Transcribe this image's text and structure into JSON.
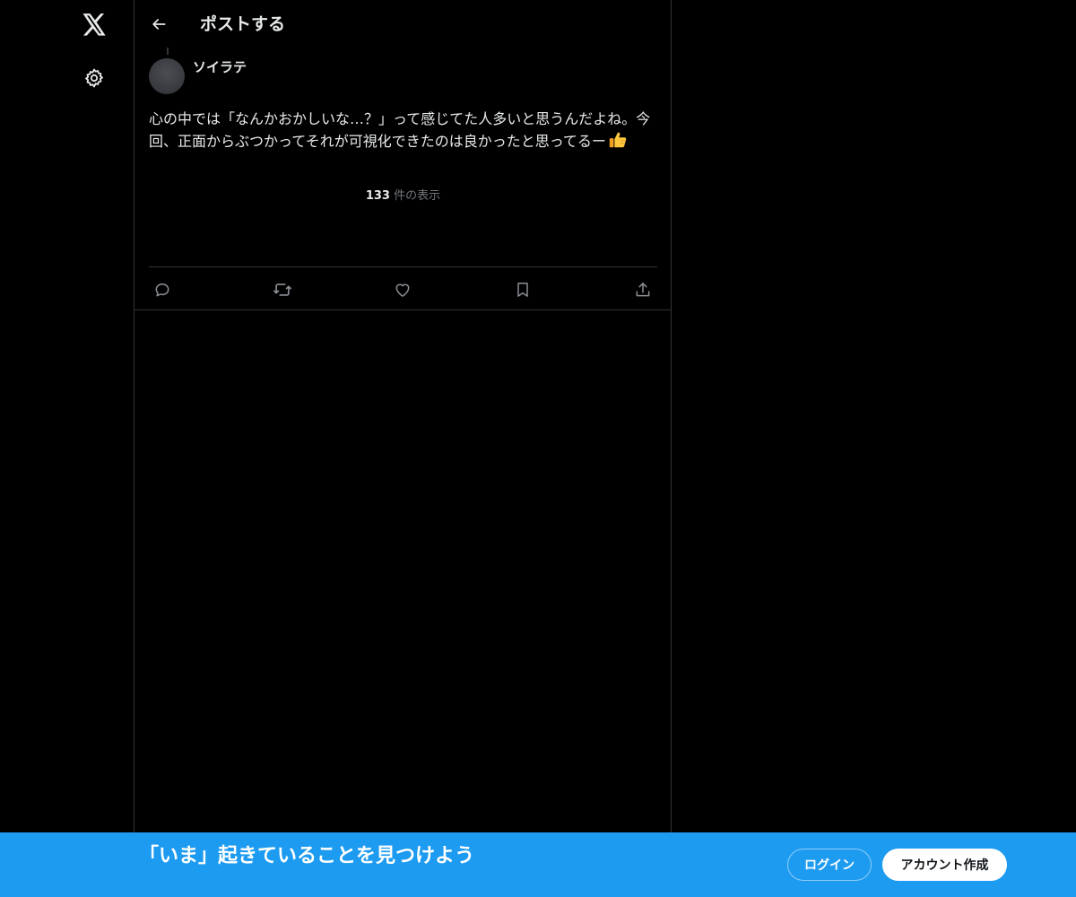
{
  "header": {
    "title": "ポストする"
  },
  "post": {
    "author_name": "ソイラテ",
    "text": "心の中では「なんかおかしいな…？」って感じてた人多いと思うんだよね。今回、正面からぶつかってそれが可視化できたのは良かったと思ってるー",
    "views": {
      "count": "133",
      "label": "件の表示"
    }
  },
  "actions": {
    "reply_icon": "reply-icon",
    "repost_icon": "repost-icon",
    "like_icon": "like-icon",
    "bookmark_icon": "bookmark-icon",
    "share_icon": "share-icon"
  },
  "banner": {
    "text": "「いま」起きていることを見つけよう",
    "login_label": "ログイン",
    "signup_label": "アカウント作成"
  },
  "colors": {
    "accent": "#1d9bf0",
    "background": "#000000",
    "text": "#e7e9ea",
    "muted": "#71767b",
    "border": "#2f3336"
  }
}
